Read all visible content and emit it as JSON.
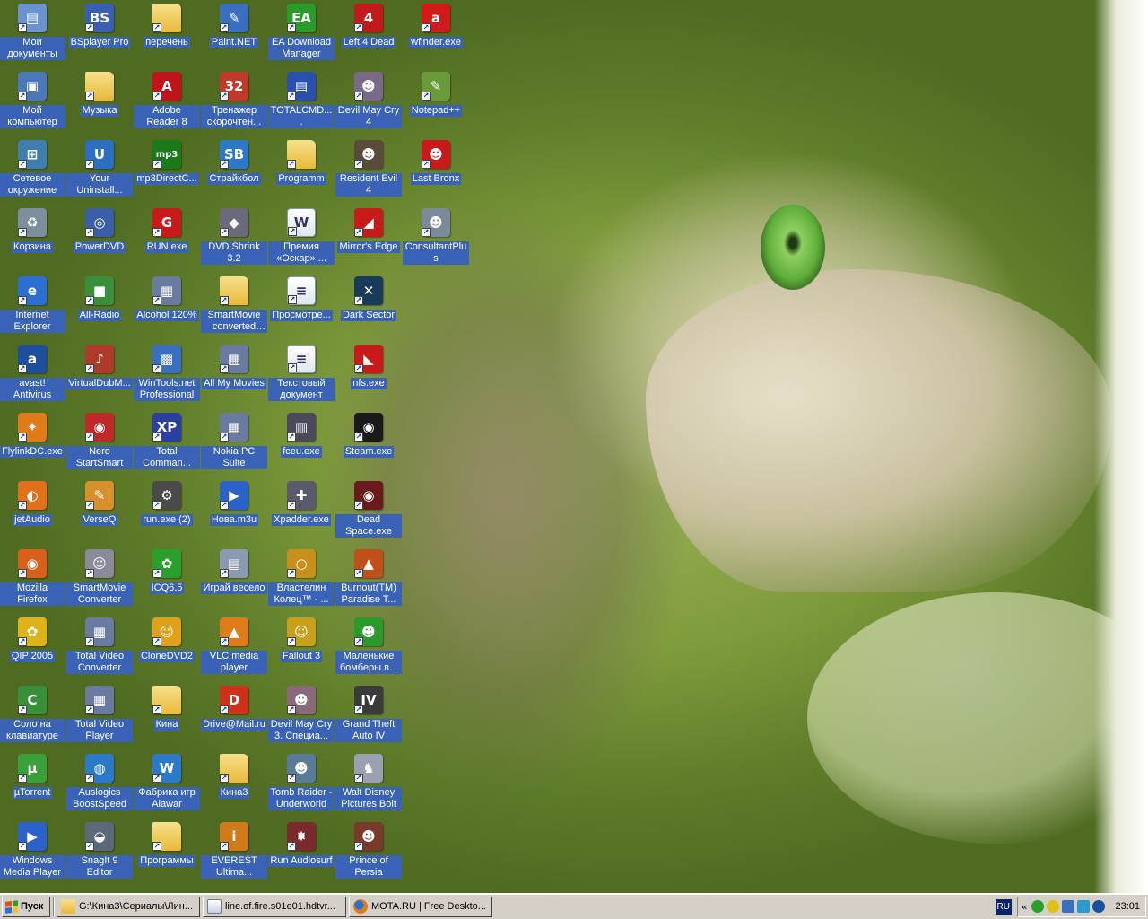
{
  "desktop": {
    "columns": [
      [
        {
          "label": "Мои документы",
          "icon": "my-documents-icon",
          "glyph": "▤",
          "color": "#6a93cf"
        },
        {
          "label": "Мой компьютер",
          "icon": "my-computer-icon",
          "glyph": "▣",
          "color": "#4a78b8"
        },
        {
          "label": "Сетевое окружение",
          "icon": "network-icon",
          "glyph": "⊞",
          "color": "#3f7fb0"
        },
        {
          "label": "Корзина",
          "icon": "recycle-bin-icon",
          "glyph": "♻",
          "color": "#7d8f9c"
        },
        {
          "label": "Internet Explorer",
          "icon": "internet-explorer-icon",
          "glyph": "e",
          "color": "#2a6fd1"
        },
        {
          "label": "avast! Antivirus",
          "icon": "avast-icon",
          "glyph": "a",
          "color": "#1d4f9c"
        },
        {
          "label": "FlylinkDC.exe",
          "icon": "flylink-icon",
          "glyph": "✦",
          "color": "#e07b1a"
        },
        {
          "label": "jetAudio",
          "icon": "jetaudio-icon",
          "glyph": "◐",
          "color": "#e0701a"
        },
        {
          "label": "Mozilla Firefox",
          "icon": "firefox-icon",
          "glyph": "◉",
          "color": "#d9601b"
        },
        {
          "label": "QIP 2005",
          "icon": "qip-icon",
          "glyph": "✿",
          "color": "#e0b21a"
        },
        {
          "label": "Соло на клавиатуре",
          "icon": "solo-icon",
          "glyph": "С",
          "color": "#3a8f3a"
        },
        {
          "label": "µTorrent",
          "icon": "utorrent-icon",
          "glyph": "µ",
          "color": "#3aa03a"
        },
        {
          "label": "Windows Media Player",
          "icon": "media-player-icon",
          "glyph": "▶",
          "color": "#2a62c9"
        }
      ],
      [
        {
          "label": "BSplayer Pro",
          "icon": "bsplayer-icon",
          "glyph": "BS",
          "color": "#3b5fb0"
        },
        {
          "label": "Музыка",
          "icon": "folder-icon",
          "glyph": "",
          "color": "folder"
        },
        {
          "label": "Your Uninstall...",
          "icon": "uninstaller-icon",
          "glyph": "U",
          "color": "#2a6fc1"
        },
        {
          "label": "PowerDVD",
          "icon": "powerdvd-icon",
          "glyph": "◎",
          "color": "#3a5fa8"
        },
        {
          "label": "All-Radio",
          "icon": "all-radio-icon",
          "glyph": "■",
          "color": "#3a8f3a"
        },
        {
          "label": "VirtualDubM...",
          "icon": "virtualdub-icon",
          "glyph": "♪",
          "color": "#b03a2a"
        },
        {
          "label": "Nero StartSmart",
          "icon": "nero-icon",
          "glyph": "◉",
          "color": "#c0282a"
        },
        {
          "label": "VerseQ",
          "icon": "verseq-icon",
          "glyph": "✎",
          "color": "#d8902a"
        },
        {
          "label": "SmartMovie Converter",
          "icon": "smartmovie-icon",
          "glyph": "☺",
          "color": "#8a8a9a"
        },
        {
          "label": "Total Video Converter",
          "icon": "total-video-converter-icon",
          "glyph": "▦",
          "color": "#6a7aa0"
        },
        {
          "label": "Total Video Player",
          "icon": "total-video-player-icon",
          "glyph": "▦",
          "color": "#6a7aa0"
        },
        {
          "label": "Auslogics BoostSpeed",
          "icon": "boostspeed-icon",
          "glyph": "◍",
          "color": "#2a7ac9"
        },
        {
          "label": "SnagIt 9 Editor",
          "icon": "snagit-icon",
          "glyph": "◒",
          "color": "#5a6a7a"
        }
      ],
      [
        {
          "label": "перечень",
          "icon": "folder-icon",
          "glyph": "",
          "color": "folder"
        },
        {
          "label": "Adobe Reader 8",
          "icon": "adobe-reader-icon",
          "glyph": "A",
          "color": "#c0141a"
        },
        {
          "label": "mp3DirectC...",
          "icon": "mp3directcut-icon",
          "glyph": "mp3",
          "color": "#1a7a1a"
        },
        {
          "label": "RUN.exe",
          "icon": "run-exe-icon",
          "glyph": "G",
          "color": "#c81a1a"
        },
        {
          "label": "Alcohol 120%",
          "icon": "alcohol-icon",
          "glyph": "▦",
          "color": "#6a7aa0"
        },
        {
          "label": "WinTools.net Professional",
          "icon": "wintools-icon",
          "glyph": "▩",
          "color": "#3a6fc0"
        },
        {
          "label": "Total Comman...",
          "icon": "total-commander-icon",
          "glyph": "XP",
          "color": "#2a3fa0"
        },
        {
          "label": "run.exe (2)",
          "icon": "gear-icon",
          "glyph": "⚙",
          "color": "#4a4a4a"
        },
        {
          "label": "ICQ6.5",
          "icon": "icq-icon",
          "glyph": "✿",
          "color": "#2aa02a"
        },
        {
          "label": "CloneDVD2",
          "icon": "clonedvd-icon",
          "glyph": "☺",
          "color": "#e0a01a"
        },
        {
          "label": "Кина",
          "icon": "folder-icon",
          "glyph": "",
          "color": "folder"
        },
        {
          "label": "Фабрика игр Alawar",
          "icon": "alawar-icon",
          "glyph": "W",
          "color": "#2a7ac9"
        },
        {
          "label": "Программы",
          "icon": "folder-icon",
          "glyph": "",
          "color": "folder"
        }
      ],
      [
        {
          "label": "Paint.NET",
          "icon": "paint-net-icon",
          "glyph": "✎",
          "color": "#3a6fc0"
        },
        {
          "label": "Тренажер скорочтен...",
          "icon": "speed-reading-icon",
          "glyph": "32",
          "color": "#c0392b"
        },
        {
          "label": "Страйкбол",
          "icon": "strikeball-icon",
          "glyph": "SB",
          "color": "#2a7ac9"
        },
        {
          "label": "DVD Shrink 3.2",
          "icon": "dvd-shrink-icon",
          "glyph": "◆",
          "color": "#6a6a7a"
        },
        {
          "label": "SmartMovie converted files",
          "icon": "folder-icon",
          "glyph": "",
          "color": "folder"
        },
        {
          "label": "All My Movies",
          "icon": "all-my-movies-icon",
          "glyph": "▦",
          "color": "#6a7aa0"
        },
        {
          "label": "Nokia PC Suite",
          "icon": "nokia-icon",
          "glyph": "▦",
          "color": "#6a7aa0"
        },
        {
          "label": "Нова.m3u",
          "icon": "playlist-icon",
          "glyph": "▶",
          "color": "#2a62c9"
        },
        {
          "label": "Играй весело",
          "icon": "play-fun-icon",
          "glyph": "▤",
          "color": "#8a9ab0"
        },
        {
          "label": "VLC media player",
          "icon": "vlc-icon",
          "glyph": "▲",
          "color": "#e07b1a"
        },
        {
          "label": "Drive@Mail.ru",
          "icon": "drive-mail-icon",
          "glyph": "D",
          "color": "#d0301a"
        },
        {
          "label": "Кина3",
          "icon": "folder-icon",
          "glyph": "",
          "color": "folder"
        },
        {
          "label": "EVEREST Ultima...",
          "icon": "everest-icon",
          "glyph": "i",
          "color": "#d07a1a"
        }
      ],
      [
        {
          "label": "EA Download Manager",
          "icon": "ea-icon",
          "glyph": "EA",
          "color": "#2a9a2a"
        },
        {
          "label": "TOTALCMD....",
          "icon": "totalcmd-icon",
          "glyph": "▤",
          "color": "#2a4fb0"
        },
        {
          "label": "Programm",
          "icon": "folder-icon",
          "glyph": "",
          "color": "folder"
        },
        {
          "label": "Премия «Оскар» ...",
          "icon": "word-doc-icon",
          "glyph": "W",
          "color": "doc"
        },
        {
          "label": "Просмотре...",
          "icon": "text-file-icon",
          "glyph": "≡",
          "color": "doc"
        },
        {
          "label": "Текстовый документ",
          "icon": "text-file-icon",
          "glyph": "≡",
          "color": "doc"
        },
        {
          "label": "fceu.exe",
          "icon": "fceu-icon",
          "glyph": "▥",
          "color": "#4a4a5a"
        },
        {
          "label": "Xpadder.exe",
          "icon": "xpadder-icon",
          "glyph": "✚",
          "color": "#5a5a6a"
        },
        {
          "label": "Властелин Колец™ - ...",
          "icon": "lotr-icon",
          "glyph": "○",
          "color": "#c8901a"
        },
        {
          "label": "Fallout 3",
          "icon": "fallout-icon",
          "glyph": "☺",
          "color": "#c8a01a"
        },
        {
          "label": "Devil May Cry 3. Специа...",
          "icon": "dmc3-icon",
          "glyph": "☻",
          "color": "#8a6a7a"
        },
        {
          "label": "Tomb Raider - Underworld",
          "icon": "tomb-raider-icon",
          "glyph": "☻",
          "color": "#5a7a9a"
        },
        {
          "label": "Run Audiosurf",
          "icon": "audiosurf-icon",
          "glyph": "✸",
          "color": "#7a2a2a"
        }
      ],
      [
        {
          "label": "Left 4 Dead",
          "icon": "left4dead-icon",
          "glyph": "4",
          "color": "#c01a1a"
        },
        {
          "label": "Devil May Cry 4",
          "icon": "dmc4-icon",
          "glyph": "☻",
          "color": "#7a6a8a"
        },
        {
          "label": "Resident Evil 4",
          "icon": "resident-evil-icon",
          "glyph": "☻",
          "color": "#5a4a3a"
        },
        {
          "label": "Mirror's Edge",
          "icon": "mirrors-edge-icon",
          "glyph": "◢",
          "color": "#c81a1a"
        },
        {
          "label": "Dark Sector",
          "icon": "dark-sector-icon",
          "glyph": "✕",
          "color": "#1a3a5a"
        },
        {
          "label": "nfs.exe",
          "icon": "nfs-icon",
          "glyph": "◣",
          "color": "#c81a1a"
        },
        {
          "label": "Steam.exe",
          "icon": "steam-icon",
          "glyph": "◉",
          "color": "#1a1a1a"
        },
        {
          "label": "Dead Space.exe",
          "icon": "dead-space-icon",
          "glyph": "◉",
          "color": "#6a1a1a"
        },
        {
          "label": "Burnout(TM) Paradise T...",
          "icon": "burnout-icon",
          "glyph": "▲",
          "color": "#c0501a"
        },
        {
          "label": "Маленькие бомберы в...",
          "icon": "bombers-icon",
          "glyph": "☻",
          "color": "#2a9a2a"
        },
        {
          "label": "Grand Theft Auto IV",
          "icon": "gta4-icon",
          "glyph": "IV",
          "color": "#3a3a3a"
        },
        {
          "label": "Walt Disney Pictures Bolt",
          "icon": "bolt-icon",
          "glyph": "♞",
          "color": "#9aa0b0"
        },
        {
          "label": "Prince of Persia",
          "icon": "prince-persia-icon",
          "glyph": "☻",
          "color": "#7a3a2a"
        }
      ],
      [
        {
          "label": "wfinder.exe",
          "icon": "wfinder-icon",
          "glyph": "a",
          "color": "#d01a1a"
        },
        {
          "label": "Notepad++",
          "icon": "notepadpp-icon",
          "glyph": "✎",
          "color": "#6a9a3a"
        },
        {
          "label": "Last Bronx",
          "icon": "last-bronx-icon",
          "glyph": "☻",
          "color": "#c81a1a"
        },
        {
          "label": "ConsultantPlus",
          "icon": "consultant-icon",
          "glyph": "☻",
          "color": "#7a8a9a"
        }
      ]
    ]
  },
  "taskbar": {
    "start_label": "Пуск",
    "tasks": [
      {
        "label": "G:\\Кина3\\Сериалы\\Лин...",
        "icon": "folder-icon"
      },
      {
        "label": "line.of.fire.s01e01.hdtvr...",
        "icon": "media-file-icon"
      },
      {
        "label": "MOTA.RU | Free Deskto...",
        "icon": "firefox-icon"
      }
    ],
    "language": "RU",
    "expand": "«",
    "clock": "23:01"
  }
}
